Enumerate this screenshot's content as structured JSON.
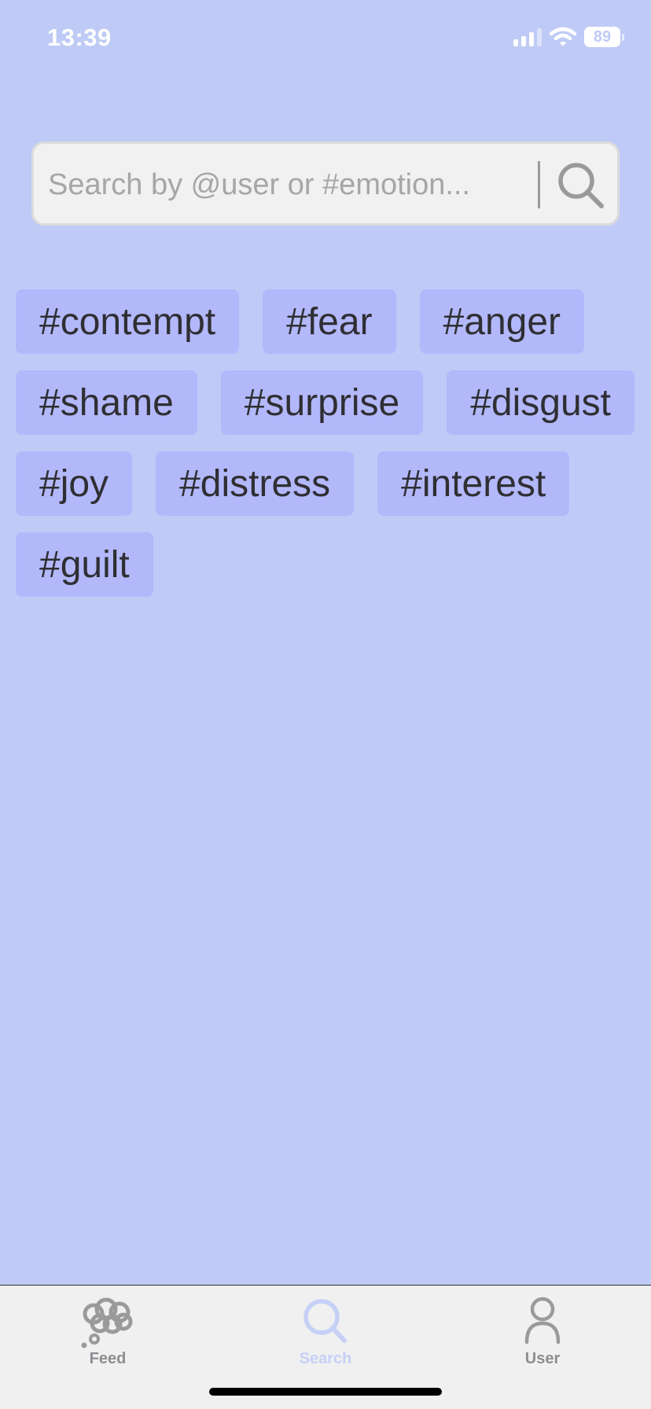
{
  "status_bar": {
    "time": "13:39",
    "battery": "89"
  },
  "search": {
    "placeholder": "Search by @user or #emotion..."
  },
  "tags": [
    "#contempt",
    "#fear",
    "#anger",
    "#shame",
    "#surprise",
    "#disgust",
    "#joy",
    "#distress",
    "#interest",
    "#guilt"
  ],
  "tab_bar": {
    "feed": {
      "label": "Feed",
      "icon": "thought-cloud-icon"
    },
    "search": {
      "label": "Search",
      "icon": "search-icon",
      "active": true
    },
    "user": {
      "label": "User",
      "icon": "user-icon"
    }
  },
  "colors": {
    "background": "#bfcbf6",
    "tag": "#b3b8fb",
    "search_field": "#f1f1f1",
    "tab_bar": "#f0f0f0",
    "active_tab": "#c6d0f7",
    "inactive_tab": "#8e8e93"
  }
}
